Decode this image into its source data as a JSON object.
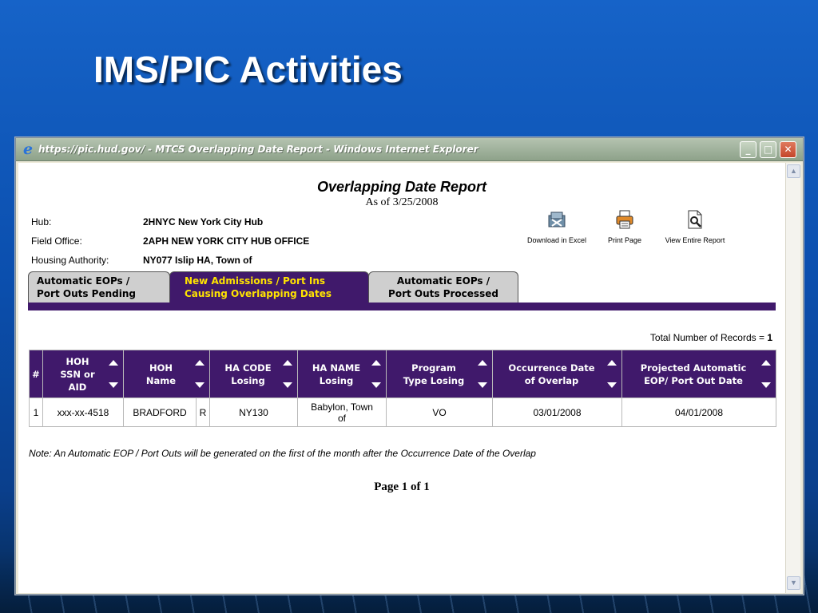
{
  "slide": {
    "title": "IMS/PIC Activities"
  },
  "window": {
    "title": "https://pic.hud.gov/ - MTCS Overlapping Date Report - Windows Internet Explorer",
    "icon": "ie-icon"
  },
  "report": {
    "title": "Overlapping Date Report",
    "as_of": "As of 3/25/2008",
    "fields": [
      {
        "label": "Hub:",
        "value": "2HNYC New York City Hub"
      },
      {
        "label": "Field Office:",
        "value": "2APH NEW YORK CITY HUB OFFICE"
      },
      {
        "label": "Housing Authority:",
        "value": "NY077 Islip HA, Town of"
      }
    ],
    "tools": [
      {
        "label": "Download in Excel",
        "icon": "excel-download-icon"
      },
      {
        "label": "Print Page",
        "icon": "printer-icon"
      },
      {
        "label": "View Entire Report",
        "icon": "magnifier-document-icon"
      }
    ],
    "tabs": [
      {
        "line1": "Automatic EOPs /",
        "line2": "Port Outs Pending",
        "active": false
      },
      {
        "line1": "New Admissions / Port Ins",
        "line2": "Causing Overlapping Dates",
        "active": true
      },
      {
        "line1": "Automatic EOPs /",
        "line2": "Port Outs Processed",
        "active": false
      }
    ],
    "total_label": "Total Number of Records =",
    "total_value": "1",
    "columns": [
      {
        "l1": "#",
        "l2": "",
        "l3": ""
      },
      {
        "l1": "HOH",
        "l2": "SSN or",
        "l3": "AID"
      },
      {
        "l1": "HOH",
        "l2": "Name",
        "l3": ""
      },
      {
        "l1": "HA CODE",
        "l2": "Losing",
        "l3": ""
      },
      {
        "l1": "HA NAME",
        "l2": "Losing",
        "l3": ""
      },
      {
        "l1": "Program",
        "l2": "Type Losing",
        "l3": ""
      },
      {
        "l1": "Occurrence Date",
        "l2": "of Overlap",
        "l3": ""
      },
      {
        "l1": "Projected Automatic",
        "l2": "EOP/ Port Out Date",
        "l3": ""
      }
    ],
    "rows": [
      {
        "num": "1",
        "ssn": "xxx-xx-4518",
        "name": "BRADFORD",
        "name_suffix": "R",
        "ha_code": "NY130",
        "ha_name": "Babylon, Town of",
        "program": "VO",
        "occurrence": "03/01/2008",
        "projected": "04/01/2008"
      }
    ],
    "note": "Note: An Automatic EOP / Port Outs will be generated on the first of the month after the Occurrence Date of the Overlap",
    "page": "Page 1 of 1"
  },
  "colors": {
    "slide_bg": "#0b4fae",
    "header_purple": "#40196b",
    "active_tab_text": "#ffe400",
    "inactive_tab": "#cfcfcf"
  }
}
